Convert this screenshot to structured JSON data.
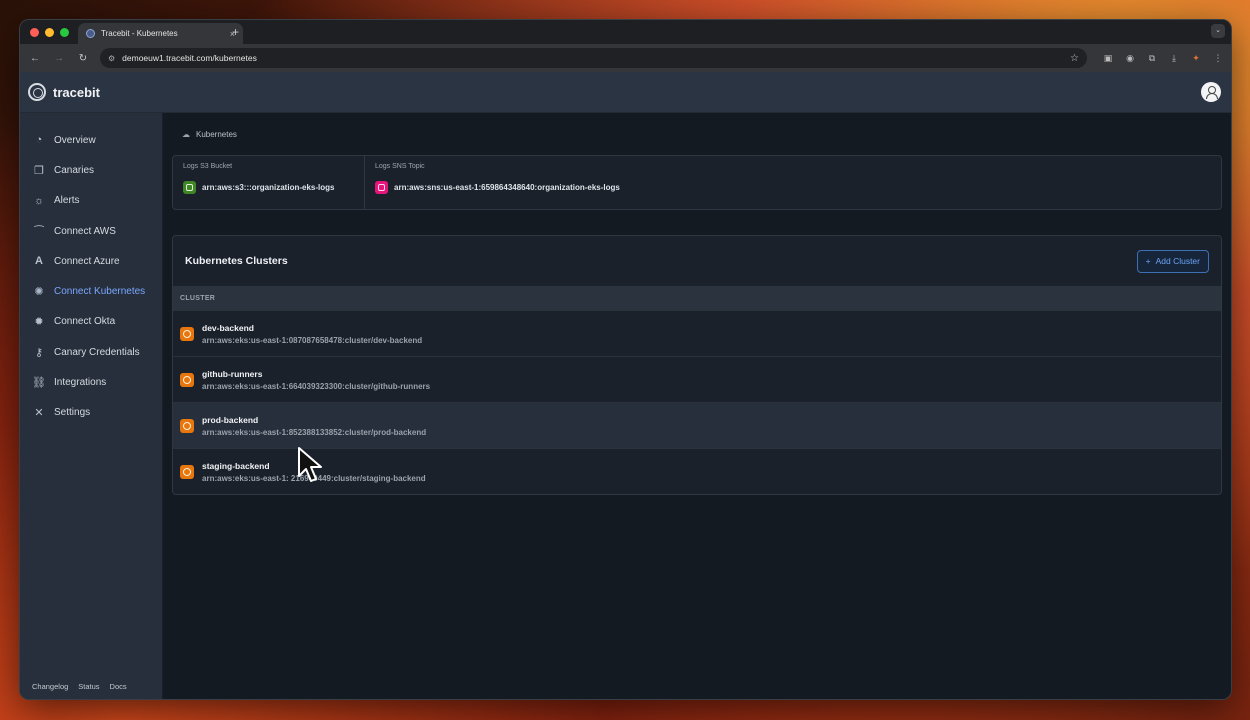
{
  "browser": {
    "tab_title": "Tracebit - Kubernetes",
    "tab_close": "×",
    "new_tab": "+",
    "url": "demoeuw1.tracebit.com/kubernetes"
  },
  "app": {
    "brand": "tracebit"
  },
  "sidebar": {
    "items": [
      {
        "label": "Overview",
        "icon": "clock-icon"
      },
      {
        "label": "Canaries",
        "icon": "copy-icon"
      },
      {
        "label": "Alerts",
        "icon": "alert-icon"
      },
      {
        "label": "Connect AWS",
        "icon": "aws-icon"
      },
      {
        "label": "Connect Azure",
        "icon": "azure-icon"
      },
      {
        "label": "Connect Kubernetes",
        "icon": "kubernetes-icon"
      },
      {
        "label": "Connect Okta",
        "icon": "okta-icon"
      },
      {
        "label": "Canary Credentials",
        "icon": "key-icon"
      },
      {
        "label": "Integrations",
        "icon": "link-icon"
      },
      {
        "label": "Settings",
        "icon": "tools-icon"
      }
    ],
    "active": "Connect Kubernetes",
    "footer": [
      "Changelog",
      "Status",
      "Docs"
    ]
  },
  "breadcrumb": {
    "label": "Kubernetes"
  },
  "logs": {
    "s3_label": "Logs S3 Bucket",
    "s3_value": "arn:aws:s3:::organization-eks-logs",
    "sns_label": "Logs SNS Topic",
    "sns_value": "arn:aws:sns:us-east-1:659864348640:organization-eks-logs"
  },
  "clusters": {
    "title": "Kubernetes Clusters",
    "add_button": "Add Cluster",
    "column": "CLUSTER",
    "rows": [
      {
        "name": "dev-backend",
        "arn": "arn:aws:eks:us-east-1:087087658478:cluster/dev-backend"
      },
      {
        "name": "github-runners",
        "arn": "arn:aws:eks:us-east-1:664039323300:cluster/github-runners"
      },
      {
        "name": "prod-backend",
        "arn": "arn:aws:eks:us-east-1:852388133852:cluster/prod-backend"
      },
      {
        "name": "staging-backend",
        "arn": "arn:aws:eks:us-east-1:  216940449:cluster/staging-backend"
      }
    ]
  },
  "colors": {
    "accent": "#7aa7ff",
    "kubernetes": "#e8760c",
    "s3": "#3f8624",
    "sns": "#e7157b"
  }
}
